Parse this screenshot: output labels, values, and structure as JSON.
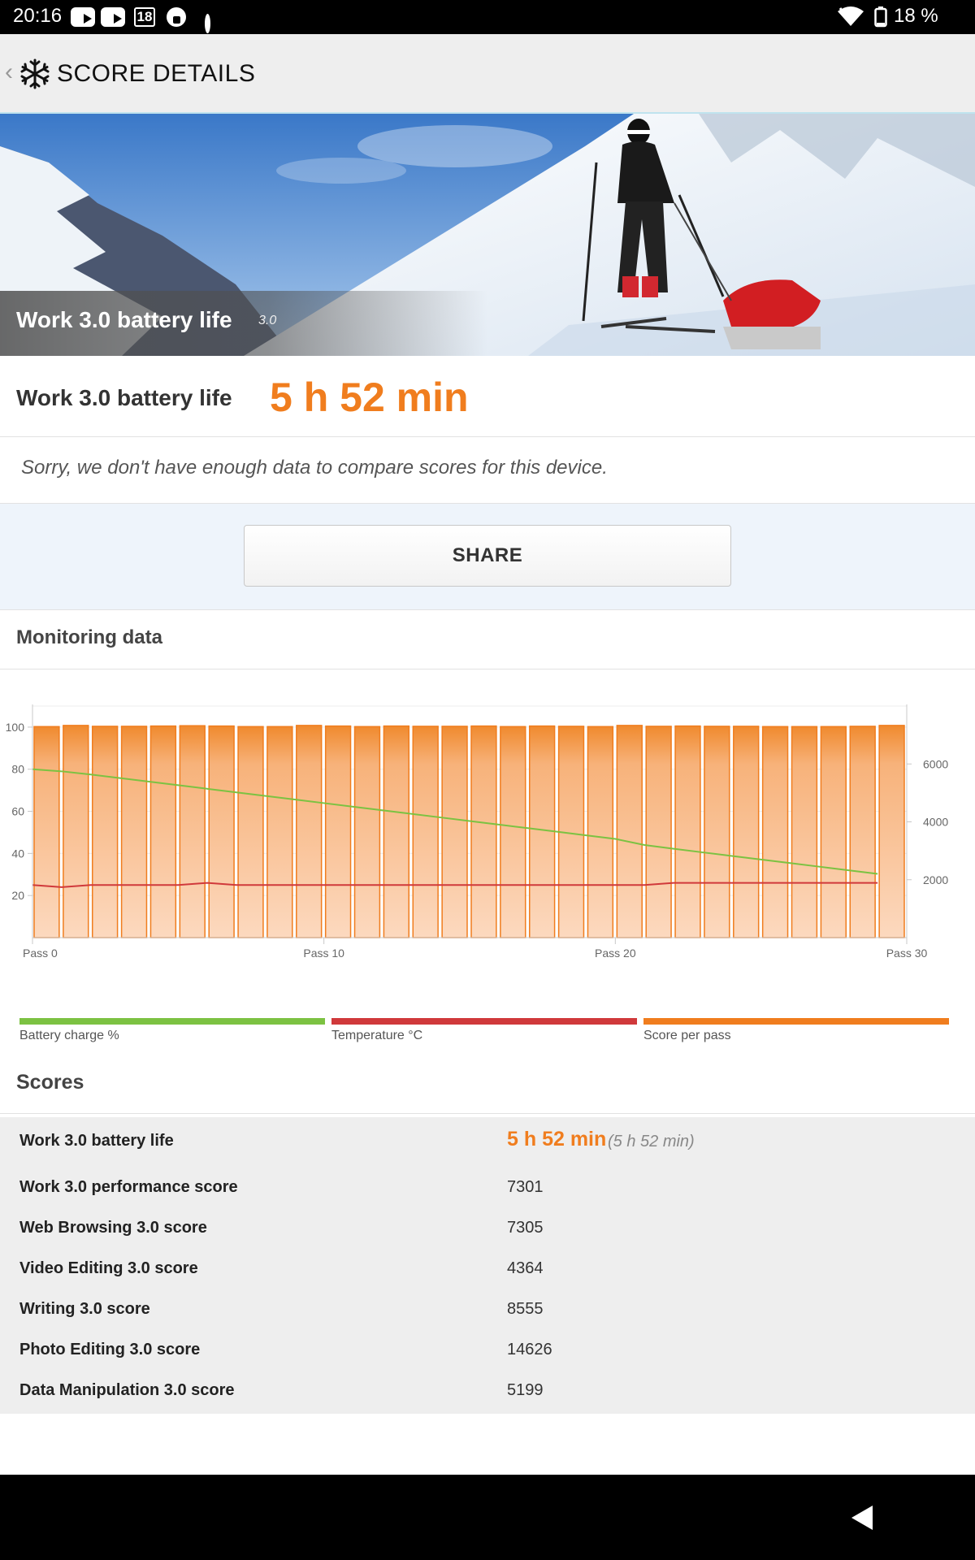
{
  "status_bar": {
    "time": "20:16",
    "calendar_day": "18",
    "battery": "18 %"
  },
  "header": {
    "title": "SCORE DETAILS"
  },
  "hero": {
    "caption": "Work 3.0 battery life",
    "version": "3.0"
  },
  "result": {
    "label": "Work 3.0 battery life",
    "value": "5 h 52 min"
  },
  "notice": "Sorry, we don't have enough data to compare scores for this device.",
  "share_label": "SHARE",
  "monitoring": {
    "title": "Monitoring data"
  },
  "legend": [
    {
      "label": "Battery charge %",
      "color": "#7cc242"
    },
    {
      "label": "Temperature °C",
      "color": "#d0393b"
    },
    {
      "label": "Score per pass",
      "color": "#f07d1e"
    }
  ],
  "chart_data": {
    "type": "bar",
    "title": "",
    "x_ticks": [
      "Pass 0",
      "Pass 10",
      "Pass 20",
      "Pass 30"
    ],
    "x_tick_passes": [
      0,
      10,
      20,
      30
    ],
    "categories": [
      0,
      1,
      2,
      3,
      4,
      5,
      6,
      7,
      8,
      9,
      10,
      11,
      12,
      13,
      14,
      15,
      16,
      17,
      18,
      19,
      20,
      21,
      22,
      23,
      24,
      25,
      26,
      27,
      28,
      29
    ],
    "left_axis": {
      "ticks": [
        20,
        40,
        60,
        80,
        100
      ],
      "range": [
        0,
        110
      ]
    },
    "right_axis": {
      "ticks": [
        2000,
        4000,
        6000
      ],
      "range": [
        0,
        8000
      ]
    },
    "series": [
      {
        "name": "Score per pass",
        "axis": "right",
        "color": "#f07d1e",
        "values": [
          7290,
          7330,
          7300,
          7300,
          7310,
          7320,
          7310,
          7290,
          7290,
          7330,
          7310,
          7290,
          7310,
          7300,
          7300,
          7310,
          7290,
          7310,
          7300,
          7290,
          7330,
          7300,
          7310,
          7300,
          7300,
          7290,
          7290,
          7290,
          7300,
          7330
        ]
      },
      {
        "name": "Battery charge %",
        "axis": "left",
        "color": "#7cc242",
        "x": [
          0,
          1,
          2,
          3,
          4,
          5,
          6,
          7,
          8,
          9,
          10,
          11,
          12,
          13,
          14,
          15,
          16,
          17,
          18,
          19,
          20,
          21,
          22,
          23,
          24,
          25,
          26,
          27,
          28,
          29
        ],
        "values": [
          80,
          79,
          77.5,
          75.8,
          74.1,
          72.4,
          70.7,
          69.0,
          67.3,
          65.6,
          63.9,
          62.2,
          60.5,
          58.8,
          57.1,
          55.4,
          53.7,
          52.0,
          50.3,
          48.6,
          46.9,
          44,
          42.2,
          40.5,
          38.8,
          37.1,
          35.4,
          33.7,
          32.0,
          30.3
        ]
      },
      {
        "name": "Temperature °C",
        "axis": "left",
        "color": "#d0393b",
        "x": [
          0,
          1,
          2,
          3,
          4,
          5,
          6,
          7,
          8,
          9,
          10,
          11,
          12,
          13,
          14,
          15,
          16,
          17,
          18,
          19,
          20,
          21,
          22,
          23,
          24,
          25,
          26,
          27,
          28,
          29
        ],
        "values": [
          25,
          24,
          25,
          25,
          25,
          25,
          26,
          25,
          25,
          25,
          25,
          25,
          25,
          25,
          25,
          25,
          25,
          25,
          25,
          25,
          25,
          25,
          26,
          26,
          26,
          26,
          26,
          26,
          26,
          26
        ]
      }
    ]
  },
  "scores": {
    "title": "Scores",
    "rows": [
      {
        "name": "Work 3.0 battery life",
        "value": "5 h 52 min",
        "sub": "(5 h 52 min)"
      },
      {
        "name": "Work 3.0 performance score",
        "value": "7301"
      },
      {
        "name": "Web Browsing 3.0 score",
        "value": "7305"
      },
      {
        "name": "Video Editing 3.0 score",
        "value": "4364"
      },
      {
        "name": "Writing 3.0 score",
        "value": "8555"
      },
      {
        "name": "Photo Editing 3.0 score",
        "value": "14626"
      },
      {
        "name": "Data Manipulation 3.0 score",
        "value": "5199"
      }
    ]
  }
}
